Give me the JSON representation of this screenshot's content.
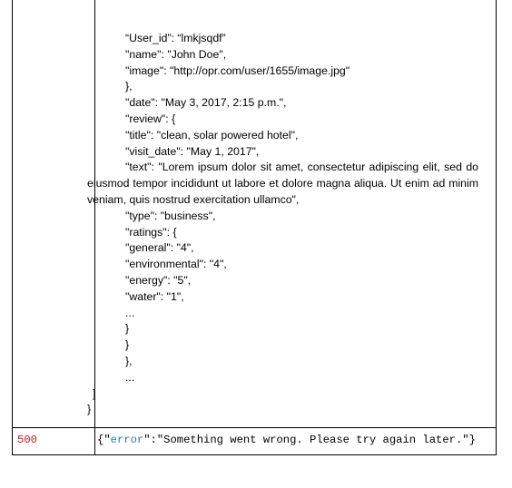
{
  "response_body_lines": {
    "l1": "“User_id”: “lmkjsqdf”",
    "l2": "\"name\": \"John Doe\",",
    "l3": "\"image\": \"http://opr.com/user/1655/image.jpg\"",
    "l4": "},",
    "l5": "\"date\": \"May 3, 2017, 2:15 p.m.\",",
    "l6": "\"review\": {",
    "l7": "\"title\": \"clean, solar powered hotel\",",
    "l8": "\"visit_date\": \"May 1, 2017\",",
    "l9": "\"text\": \"Lorem ipsum dolor sit amet, consectetur adipiscing elit, sed do eiusmod tempor incididunt ut labore et dolore magna aliqua. Ut enim ad minim veniam, quis nostrud exercitation ullamco\",",
    "l10": "\"type\": \"business\",",
    "l11": "\"ratings\": {",
    "l12": "\"general\": \"4\",",
    "l13": "\"environmental\": \"4\",",
    "l14": "\"energy\": \"5\",",
    "l15": "\"water\": \"1\",",
    "l16": "...",
    "l17": "}",
    "l18": "}",
    "l19": "},",
    "l20": "...",
    "l21": "]",
    "l22": "}"
  },
  "error_row": {
    "status_code": "500",
    "open": "{\"",
    "key": "error",
    "rest": "\":\"Something went wrong. Please try again later.\"}"
  },
  "colors": {
    "status_code": "#b31b1b",
    "json_key": "#2a7ab5",
    "border": "#000000"
  }
}
